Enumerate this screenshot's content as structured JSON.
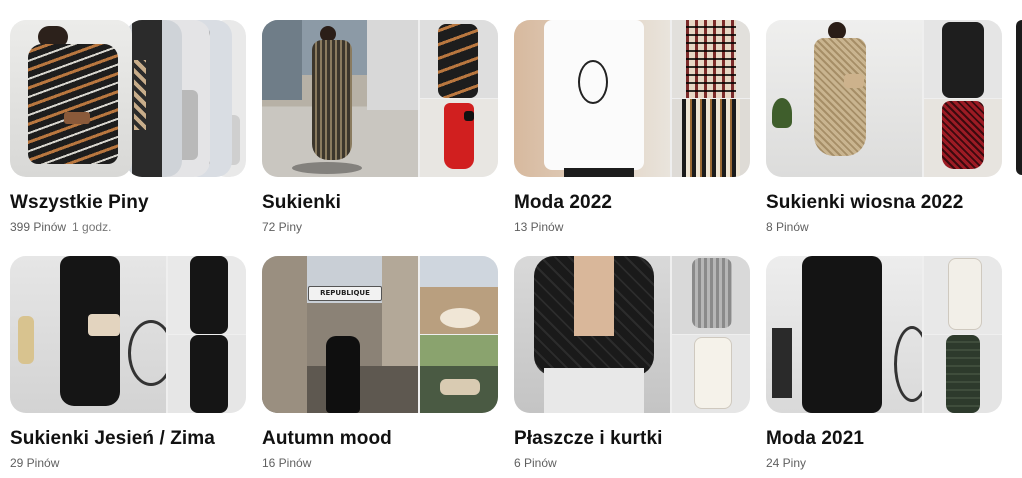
{
  "boards": [
    {
      "title": "Wszystkie Piny",
      "count": "399 Pinów",
      "time": "1 godz."
    },
    {
      "title": "Sukienki",
      "count": "72 Piny"
    },
    {
      "title": "Moda 2022",
      "count": "13 Pinów"
    },
    {
      "title": "Sukienki wiosna 2022",
      "count": "8 Pinów"
    },
    {
      "title": "Sukienki Jesień / Zima",
      "count": "29 Pinów"
    },
    {
      "title": "Autumn mood",
      "count": "16 Pinów"
    },
    {
      "title": "Płaszcze i kurtki",
      "count": "6 Pinów"
    },
    {
      "title": "Moda 2021",
      "count": "24 Piny"
    }
  ],
  "image_labels": {
    "street_sign": "REPUBLIQUE"
  }
}
